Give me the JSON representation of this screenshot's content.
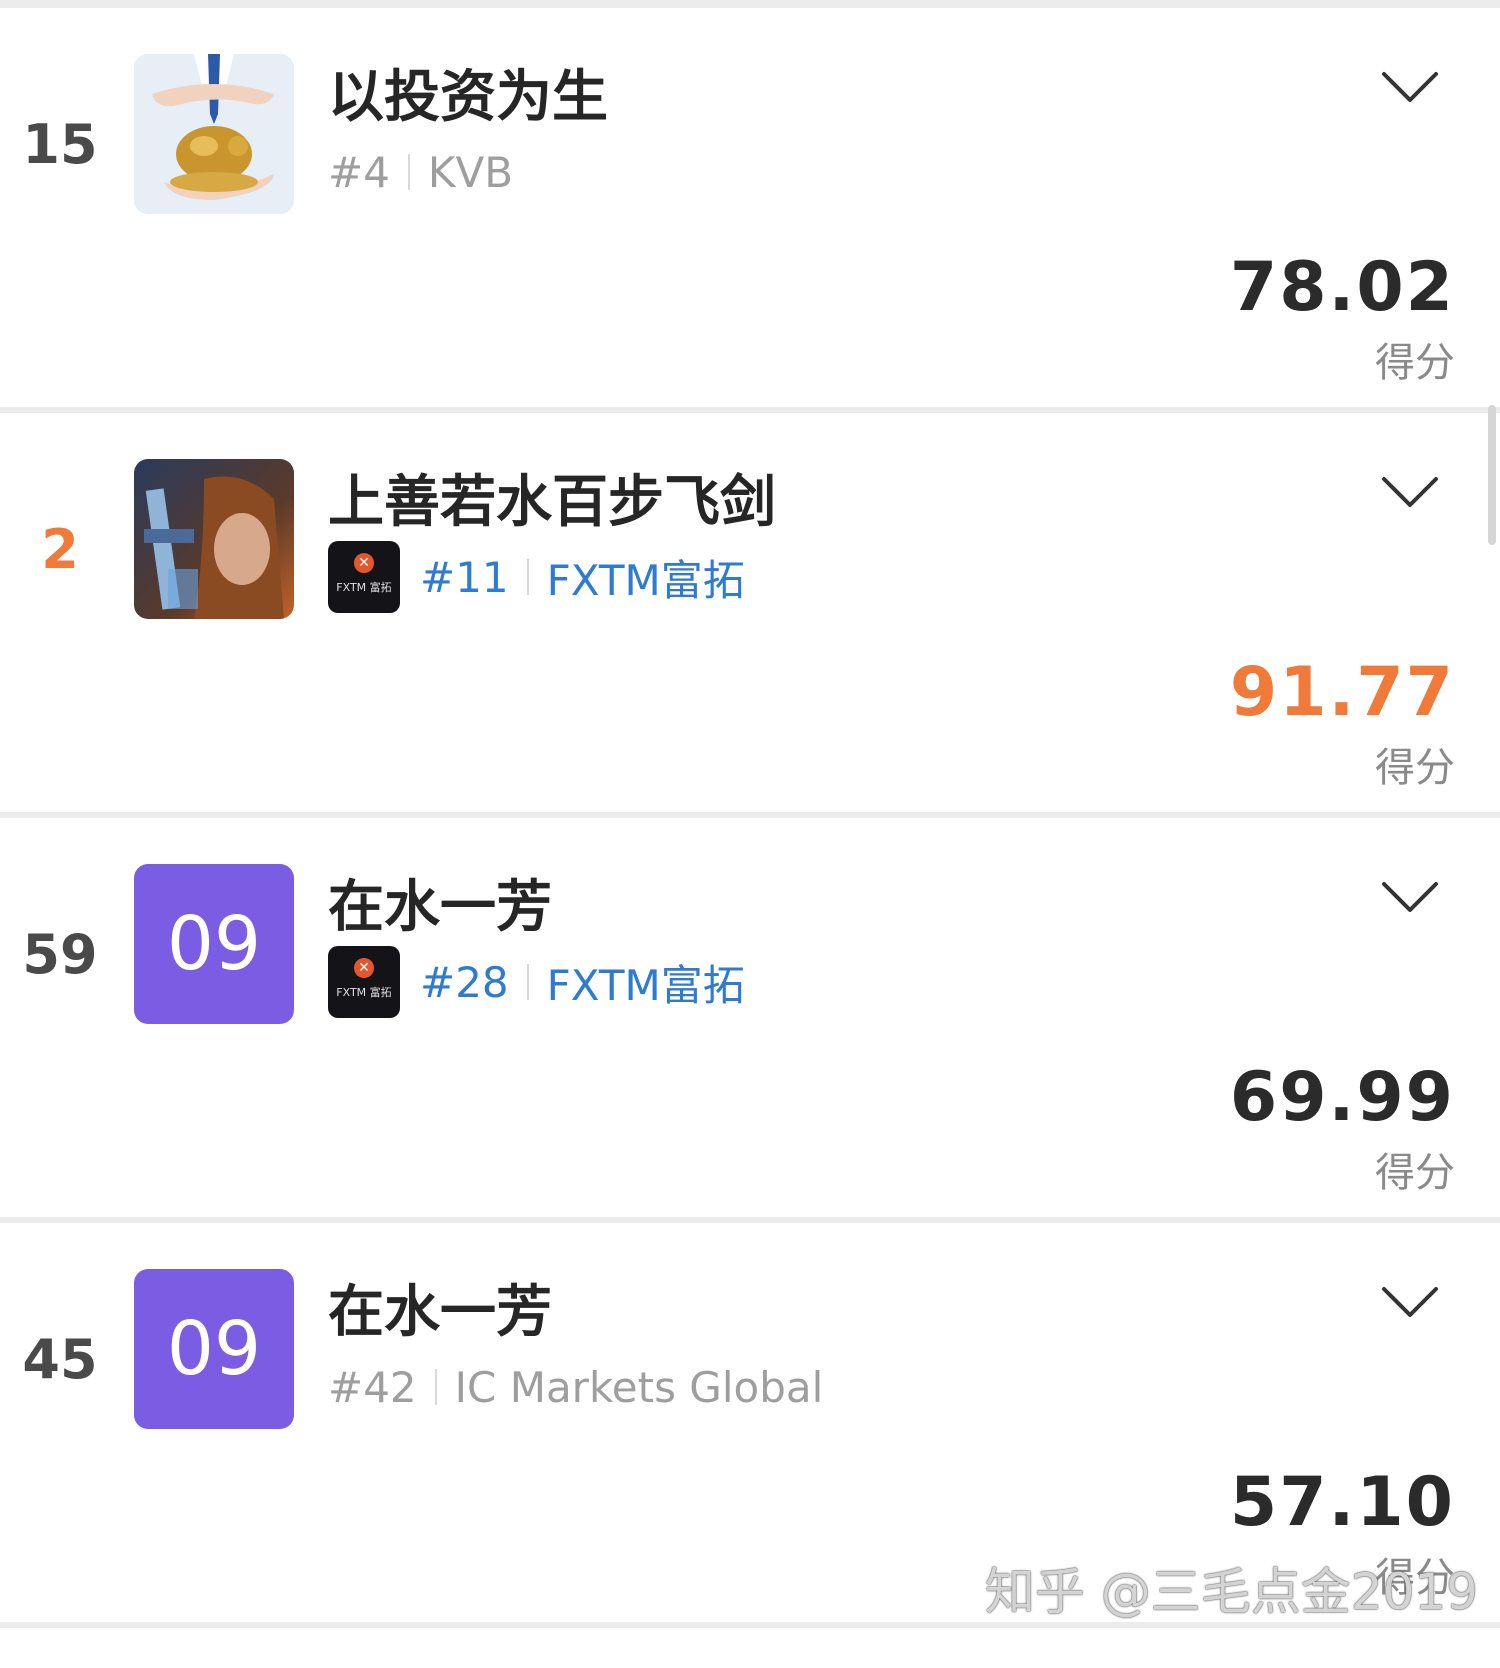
{
  "score_label": "得分",
  "rows": [
    {
      "rank": "15",
      "avatar_type": "image-piggybank",
      "name": "以投资为生",
      "rank_tag": "#4",
      "broker": "KVB",
      "score": "78.02"
    },
    {
      "rank": "2",
      "avatar_type": "image-game-character",
      "name": "上善若水百步飞剑",
      "broker_logo_text": "FXTM 富拓",
      "rank_tag": "#11",
      "broker": "FXTM富拓",
      "score": "91.77"
    },
    {
      "rank": "59",
      "avatar_type": "letter",
      "avatar_text": "09",
      "name": "在水一芳",
      "broker_logo_text": "FXTM 富拓",
      "rank_tag": "#28",
      "broker": "FXTM富拓",
      "score": "69.99"
    },
    {
      "rank": "45",
      "avatar_type": "letter",
      "avatar_text": "09",
      "name": "在水一芳",
      "rank_tag": "#42",
      "broker": "IC Markets Global",
      "score": "57.10"
    }
  ],
  "colors": {
    "highlight": "#f07a3a",
    "broker_link": "#2f7bd0",
    "avatar_purple": "#7b5de3"
  },
  "watermark": "知乎 @三毛点金2019"
}
